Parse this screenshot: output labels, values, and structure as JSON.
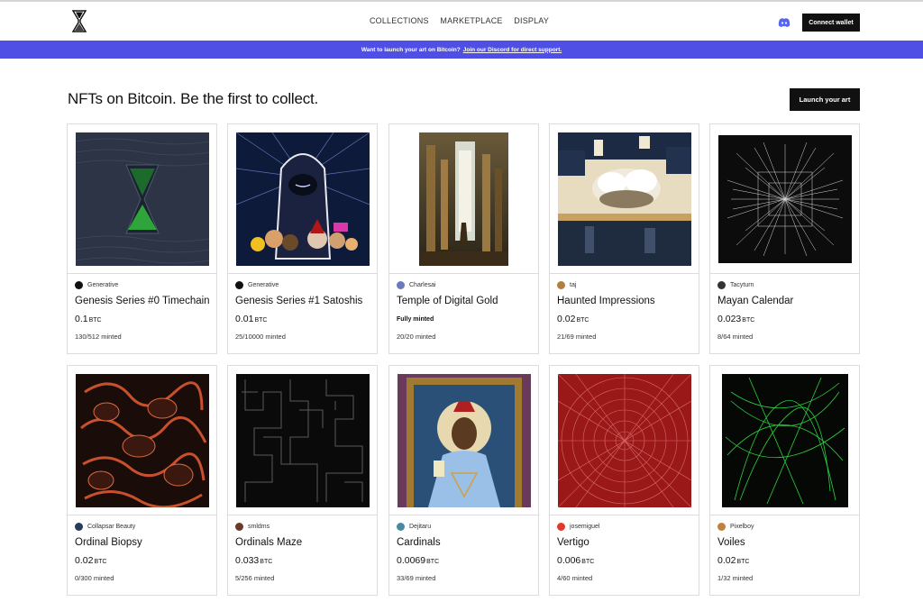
{
  "nav": {
    "links": [
      "COLLECTIONS",
      "MARKETPLACE",
      "DISPLAY"
    ],
    "connect_label": "Connect wallet",
    "logo_icon": "hourglass-logo-icon",
    "discord_icon": "discord-icon"
  },
  "banner": {
    "text": "Want to launch your art on Bitcoin?",
    "link_text": "Join our Discord for direct support."
  },
  "main": {
    "heading": "NFTs on Bitcoin. Be the first to collect.",
    "launch_label": "Launch your art"
  },
  "colors": {
    "banner_bg": "#4f4fe6",
    "button_bg": "#111111"
  },
  "collections": [
    {
      "creator": "Generative",
      "title": "Genesis Series #0 Timechain",
      "price": "0.1",
      "unit": "BTC",
      "minted": "130/512 minted",
      "status": ""
    },
    {
      "creator": "Generative",
      "title": "Genesis Series #1 Satoshis",
      "price": "0.01",
      "unit": "BTC",
      "minted": "25/10000 minted",
      "status": ""
    },
    {
      "creator": "Charlesai",
      "title": "Temple of Digital Gold",
      "price": "",
      "unit": "",
      "minted": "20/20 minted",
      "status": "Fully minted"
    },
    {
      "creator": "taj",
      "title": "Haunted Impressions",
      "price": "0.02",
      "unit": "BTC",
      "minted": "21/69 minted",
      "status": ""
    },
    {
      "creator": "Tacyturn",
      "title": "Mayan Calendar",
      "price": "0.023",
      "unit": "BTC",
      "minted": "8/64 minted",
      "status": ""
    },
    {
      "creator": "Collapsar Beauty",
      "title": "Ordinal Biopsy",
      "price": "0.02",
      "unit": "BTC",
      "minted": "0/300 minted",
      "status": ""
    },
    {
      "creator": "smldms",
      "title": "Ordinals Maze",
      "price": "0.033",
      "unit": "BTC",
      "minted": "5/256 minted",
      "status": ""
    },
    {
      "creator": "Dejitaru",
      "title": "Cardinals",
      "price": "0.0069",
      "unit": "BTC",
      "minted": "33/69 minted",
      "status": ""
    },
    {
      "creator": "josemiguel",
      "title": "Vertigo",
      "price": "0.006",
      "unit": "BTC",
      "minted": "4/60 minted",
      "status": ""
    },
    {
      "creator": "Pixelboy",
      "title": "Voiles",
      "price": "0.02",
      "unit": "BTC",
      "minted": "1/32 minted",
      "status": ""
    }
  ]
}
